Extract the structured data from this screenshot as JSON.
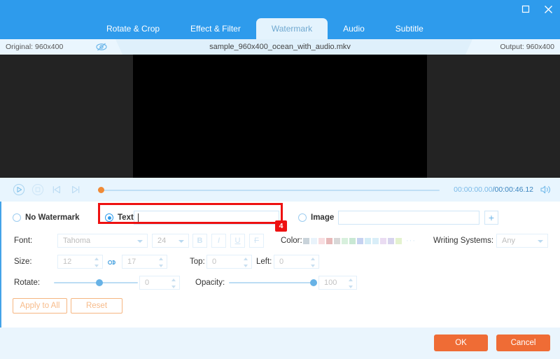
{
  "titlebar": {
    "maximize_icon": "maximize-icon",
    "close_icon": "close-icon"
  },
  "tabs": [
    {
      "label": "Rotate & Crop",
      "active": false
    },
    {
      "label": "Effect & Filter",
      "active": false
    },
    {
      "label": "Watermark",
      "active": true
    },
    {
      "label": "Audio",
      "active": false
    },
    {
      "label": "Subtitle",
      "active": false
    }
  ],
  "infobar": {
    "original_label": "Original: 960x400",
    "filename": "sample_960x400_ocean_with_audio.mkv",
    "output_label": "Output: 960x400",
    "preview_toggle_icon": "eye-slash-icon"
  },
  "player": {
    "play_icon": "play-circle-icon",
    "stop_icon": "stop-circle-icon",
    "prev_frame_icon": "previous-frame-icon",
    "next_frame_icon": "next-frame-icon",
    "current_time": "00:00:00.00",
    "time_separator": "/",
    "total_time": "00:00:46.12",
    "volume_icon": "volume-icon",
    "seek_position_pct": 0
  },
  "watermark": {
    "no_watermark_label": "No Watermark",
    "no_watermark_selected": false,
    "text_label": "Text",
    "text_selected": true,
    "text_value": "",
    "image_label": "Image",
    "image_selected": false,
    "image_value": "",
    "add_image_button": "+",
    "font_label": "Font:",
    "font_family": "Tahoma",
    "font_size": "24",
    "bold_label": "B",
    "italic_label": "I",
    "underline_label": "U",
    "strikethrough_label": "F",
    "color_label": "Color:",
    "color_more": "···",
    "color_swatches": [
      "#c9d3da",
      "#e9f3fb",
      "#f8dde0",
      "#e7b9b9",
      "#d8d8d8",
      "#d8f0dd",
      "#c9e8d4",
      "#c6d2f1",
      "#d4edf6",
      "#d9eef8",
      "#eadcf2",
      "#d7d4ee",
      "#e4f2cf"
    ],
    "writing_systems_label": "Writing Systems:",
    "writing_systems_value": "Any",
    "size_label": "Size:",
    "size_width": "12",
    "size_height": "17",
    "link_icon": "link-chain-icon",
    "top_label": "Top:",
    "top_value": "0",
    "left_label": "Left:",
    "left_value": "0",
    "rotate_label": "Rotate:",
    "rotate_value": "0",
    "rotate_slider_pct": 50,
    "opacity_label": "Opacity:",
    "opacity_value": "100",
    "opacity_slider_pct": 100,
    "apply_to_all_label": "Apply to All",
    "reset_label": "Reset"
  },
  "footer": {
    "ok_label": "OK",
    "cancel_label": "Cancel"
  },
  "annotation": {
    "badge_number": "4",
    "highlight_color": "#ee1111"
  }
}
